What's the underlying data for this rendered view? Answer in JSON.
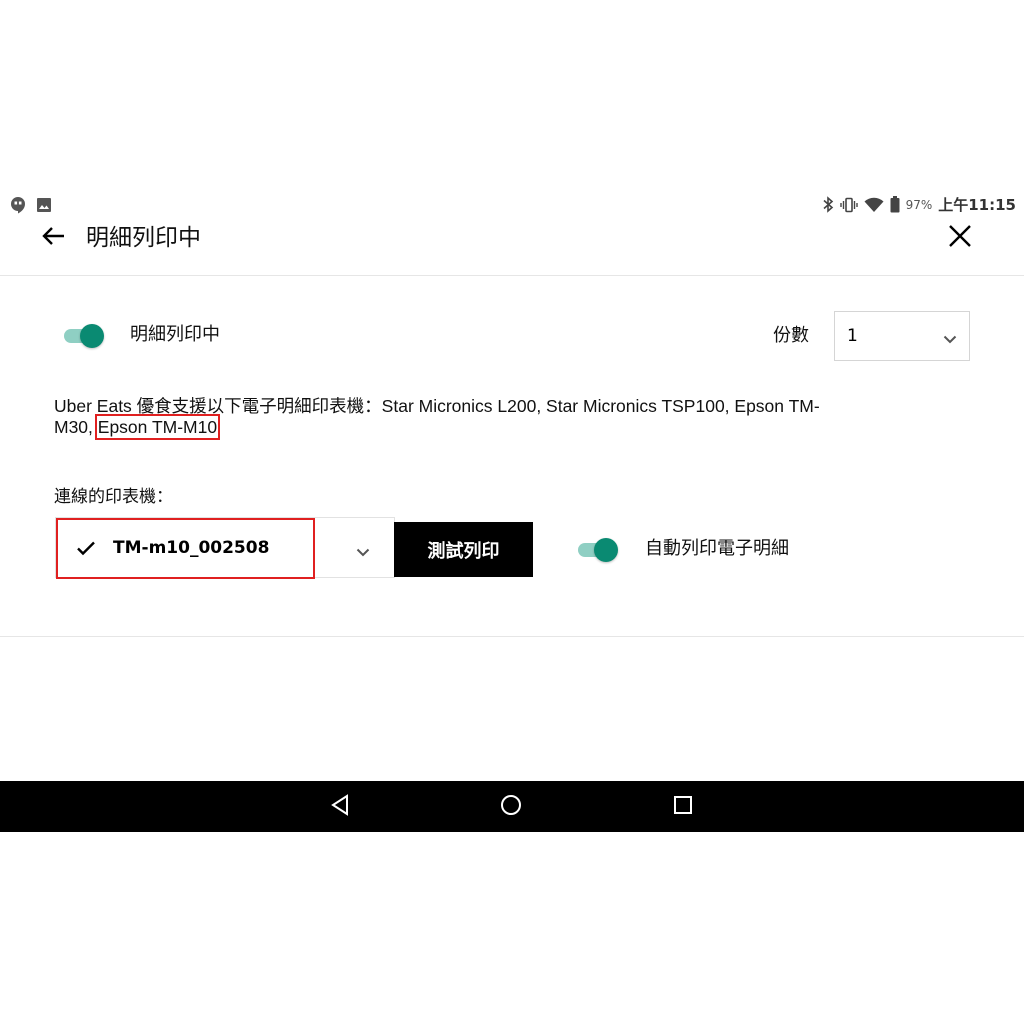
{
  "status_bar": {
    "battery_percent": "97%",
    "time": "上午11:15",
    "icons": [
      "hangouts-icon",
      "image-icon",
      "bluetooth-icon",
      "vibrate-icon",
      "wifi-icon",
      "battery-icon"
    ]
  },
  "header": {
    "title": "明細列印中"
  },
  "print_section": {
    "toggle_label": "明細列印中",
    "toggle_on": true,
    "copies_label": "份數",
    "copies_value": "1",
    "support_prefix": "Uber Eats 優食支援以下電子明細印表機：Star Micronics L200, Star Micronics TSP100, Epson TM-M30,",
    "support_highlight": "Epson TM-M10",
    "connected_label": "連線的印表機：",
    "printer_value": "TM-m10_002508",
    "test_button": "測試列印",
    "auto_print_label": "自動列印電子明細",
    "auto_print_on": true
  },
  "colors": {
    "toggle_thumb": "#0a8a72",
    "toggle_track": "#8fcfc3",
    "highlight": "#e02020",
    "button_bg": "#000000"
  }
}
